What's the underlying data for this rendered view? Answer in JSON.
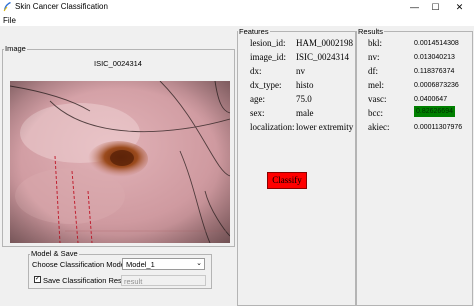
{
  "window": {
    "title": "Skin Cancer Classification",
    "minimize": "—",
    "maximize": "☐",
    "close": "✕"
  },
  "menu": {
    "file": "File"
  },
  "image_panel": {
    "label": "Image",
    "image_name": "ISIC_0024314"
  },
  "features": {
    "label": "Features",
    "rows": [
      {
        "key": "lesion_id:",
        "value": "HAM_0002198"
      },
      {
        "key": "image_id:",
        "value": "ISIC_0024314"
      },
      {
        "key": "dx:",
        "value": "nv"
      },
      {
        "key": "dx_type:",
        "value": "histo"
      },
      {
        "key": "age:",
        "value": "75.0"
      },
      {
        "key": "sex:",
        "value": "male"
      },
      {
        "key": "localization:",
        "value": "lower extremity"
      }
    ],
    "classify_label": "Classify",
    "classify_color": "#ff0000"
  },
  "results": {
    "label": "Results",
    "rows": [
      {
        "key": "bkl:",
        "value": "0.0014514308"
      },
      {
        "key": "nv:",
        "value": "0.013040213"
      },
      {
        "key": "df:",
        "value": "0.118376374"
      },
      {
        "key": "mel:",
        "value": "0.0006873236"
      },
      {
        "key": "vasc:",
        "value": "0.0400647"
      },
      {
        "key": "bcc:",
        "value": "0.82626694"
      },
      {
        "key": "akiec:",
        "value": "0.00011307976"
      }
    ],
    "highlight_color": "#008000"
  },
  "model_save": {
    "label": "Model & Save",
    "choose_label": "Choose Classification Model:",
    "selected_model": "Model_1",
    "save_label": "Save Classification Results",
    "save_checked": true,
    "save_entry_value": "result"
  }
}
